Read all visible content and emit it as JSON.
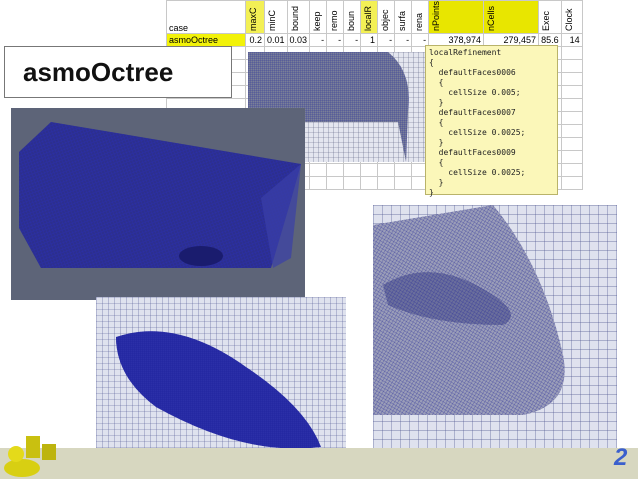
{
  "slide": {
    "title": "asmoOctree",
    "page_number": "2"
  },
  "spreadsheet": {
    "headers": [
      "case",
      "maxC",
      "minC",
      "bound",
      "keep",
      "remo",
      "boun",
      "localR",
      "objec",
      "surfa",
      "rena",
      "nPoints",
      "nCells",
      "Exec",
      "Clock"
    ],
    "row": [
      "asmoOctree",
      "0.2",
      "0.01",
      "0.03",
      "-",
      "-",
      "-",
      "1",
      "-",
      "-",
      "-",
      "378,974",
      "279,457",
      "85.6",
      "14"
    ]
  },
  "code": {
    "text": "localRefinement\n{\n  defaultFaces0006\n  {\n    cellSize 0.005;\n  }\n  defaultFaces0007\n  {\n    cellSize 0.0025;\n  }\n  defaultFaces0009\n  {\n    cellSize 0.0025;\n  }\n}"
  },
  "colors": {
    "mesh_bg": "#5d6478",
    "mesh_line": "#1f1f9a",
    "light_mesh_bg": "#dfe2ee",
    "footer": "#d7d7c0",
    "accent": "#3a5fcd"
  }
}
